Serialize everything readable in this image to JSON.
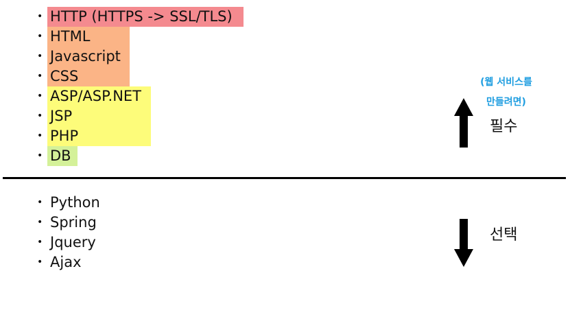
{
  "required_list": [
    {
      "label": "HTTP (HTTPS -> SSL/TLS)",
      "highlight": "#f48a8f"
    },
    {
      "label": "HTML",
      "highlight": "#fbb486"
    },
    {
      "label": "Javascript",
      "highlight": "#fbb486"
    },
    {
      "label": "CSS",
      "highlight": "#fbb486"
    },
    {
      "label": "ASP/ASP.NET",
      "highlight": "#fdfc7a"
    },
    {
      "label": "JSP",
      "highlight": "#fdfc7a"
    },
    {
      "label": "PHP",
      "highlight": "#fdfc7a"
    },
    {
      "label": "DB",
      "highlight": "#d4f199"
    }
  ],
  "optional_list": [
    {
      "label": "Python"
    },
    {
      "label": "Spring"
    },
    {
      "label": "Jquery"
    },
    {
      "label": "Ajax"
    }
  ],
  "bullet": "•",
  "note": {
    "line1": "(웹 서비스를",
    "line2": "만들려면)",
    "color": "#1e9de0"
  },
  "required_label": "필수",
  "optional_label": "선택",
  "icons": {
    "up": "arrow-up-icon",
    "down": "arrow-down-icon"
  }
}
